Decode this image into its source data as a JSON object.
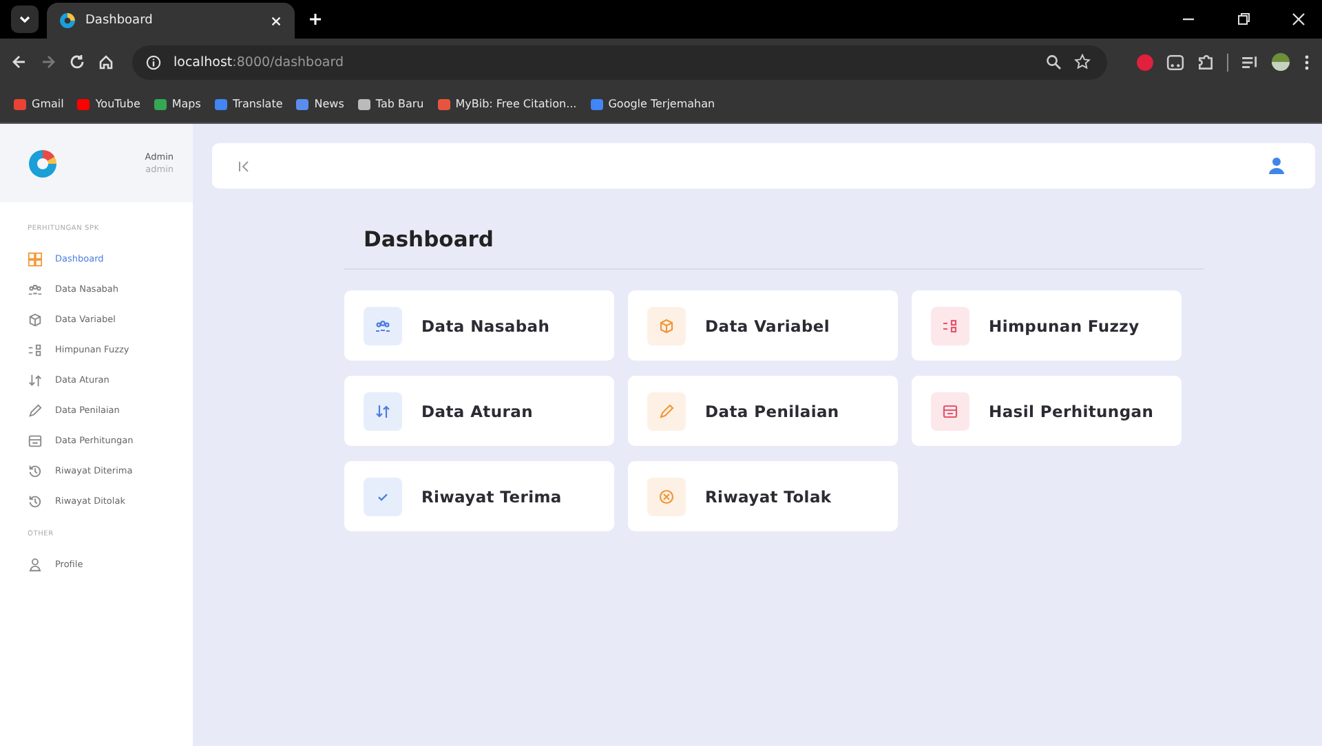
{
  "browser": {
    "tab": {
      "title": "Dashboard",
      "selected": true
    },
    "address": {
      "host": "localhost",
      "path": ":8000/dashboard"
    },
    "bookmarks": [
      {
        "label": "Gmail",
        "color": "#ea4335"
      },
      {
        "label": "YouTube",
        "color": "#ff0000"
      },
      {
        "label": "Maps",
        "color": "#34a853"
      },
      {
        "label": "Translate",
        "color": "#4285f4"
      },
      {
        "label": "News",
        "color": "#5b8def"
      },
      {
        "label": "Tab Baru",
        "color": "#bbbbbb"
      },
      {
        "label": "MyBib: Free Citation...",
        "color": "#e8553e"
      },
      {
        "label": "Google Terjemahan",
        "color": "#4285f4"
      }
    ]
  },
  "sidebar": {
    "user": {
      "name": "Admin",
      "role": "admin"
    },
    "sections": [
      {
        "title": "PERHITUNGAN SPK",
        "items": [
          {
            "label": "Dashboard",
            "selected": true
          },
          {
            "label": "Data Nasabah",
            "selected": false
          },
          {
            "label": "Data Variabel",
            "selected": false
          },
          {
            "label": "Himpunan Fuzzy",
            "selected": false
          },
          {
            "label": "Data Aturan",
            "selected": false
          },
          {
            "label": "Data Penilaian",
            "selected": false
          },
          {
            "label": "Data Perhitungan",
            "selected": false
          },
          {
            "label": "Riwayat Diterima",
            "selected": false
          },
          {
            "label": "Riwayat Ditolak",
            "selected": false
          }
        ]
      },
      {
        "title": "OTHER",
        "items": [
          {
            "label": "Profile",
            "selected": false
          }
        ]
      }
    ]
  },
  "main": {
    "title": "Dashboard",
    "cards": [
      {
        "label": "Data Nasabah",
        "color": "#4a7de0"
      },
      {
        "label": "Data Variabel",
        "color": "#f0963a"
      },
      {
        "label": "Himpunan Fuzzy",
        "color": "#e8536a"
      },
      {
        "label": "Data Aturan",
        "color": "#4a7de0"
      },
      {
        "label": "Data Penilaian",
        "color": "#f0963a"
      },
      {
        "label": "Hasil Perhitungan",
        "color": "#e8536a"
      },
      {
        "label": "Riwayat Terima",
        "color": "#4a7de0"
      },
      {
        "label": "Riwayat Tolak",
        "color": "#f0963a"
      }
    ]
  }
}
